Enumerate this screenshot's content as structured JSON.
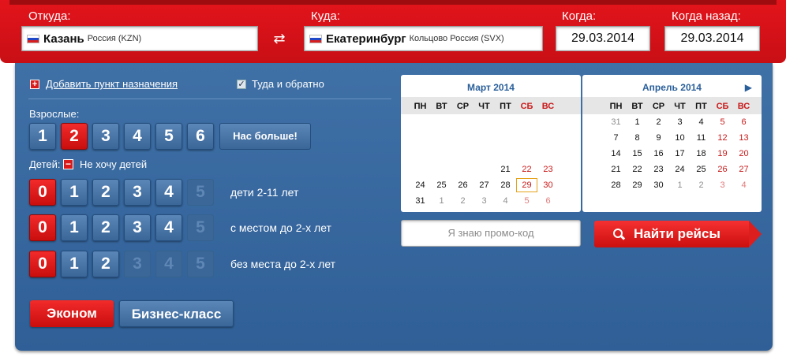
{
  "search": {
    "from_label": "Откуда:",
    "to_label": "Куда:",
    "when_label": "Когда:",
    "back_label": "Когда назад:",
    "from_city": "Казань",
    "from_sub": "Россия (KZN)",
    "to_city": "Екатеринбург",
    "to_sub": "Кольцово Россия (SVX)",
    "depart_date": "29.03.2014",
    "return_date": "29.03.2014",
    "swap_glyph": "⇄"
  },
  "options": {
    "add_destination": "Добавить пункт назначения",
    "add_glyph": "+",
    "roundtrip": "Туда и обратно",
    "roundtrip_checked": true,
    "check_glyph": "✓"
  },
  "adults": {
    "label": "Взрослые:",
    "numbers": [
      "1",
      "2",
      "3",
      "4",
      "5",
      "6"
    ],
    "selected": "2",
    "more_label": "Нас больше!"
  },
  "children": {
    "label": "Детей:",
    "no_children": "Не хочу детей",
    "minus_glyph": "−",
    "rows": [
      {
        "label": "дети 2-11 лет",
        "numbers": [
          "0",
          "1",
          "2",
          "3",
          "4",
          "5"
        ]
      },
      {
        "label": "с местом до 2-х лет",
        "numbers": [
          "0",
          "1",
          "2",
          "3",
          "4",
          "5"
        ]
      },
      {
        "label": "без места до 2-х лет",
        "numbers": [
          "0",
          "1",
          "2",
          "3",
          "4",
          "5"
        ]
      }
    ]
  },
  "classes": {
    "economy": "Эконом",
    "business": "Бизнес-класс"
  },
  "calendar": {
    "weekdays": [
      "ПН",
      "ВТ",
      "СР",
      "ЧТ",
      "ПТ",
      "СБ",
      "ВС"
    ],
    "months": [
      {
        "title": "Март 2014",
        "days": [
          [
            "",
            "",
            "",
            "",
            "",
            "",
            ""
          ],
          [
            "",
            "",
            "",
            "",
            "",
            "",
            ""
          ],
          [
            "",
            "",
            "",
            "",
            "",
            "",
            ""
          ],
          [
            "",
            "",
            "",
            "",
            "21",
            "22",
            "23"
          ],
          [
            "24",
            "25",
            "26",
            "27",
            "28",
            "29",
            "30"
          ],
          [
            "31",
            "1",
            "2",
            "3",
            "4",
            "5",
            "6"
          ]
        ]
      },
      {
        "title": "Апрель 2014",
        "next_glyph": "▶",
        "days": [
          [
            "31",
            "1",
            "2",
            "3",
            "4",
            "5",
            "6"
          ],
          [
            "7",
            "8",
            "9",
            "10",
            "11",
            "12",
            "13"
          ],
          [
            "14",
            "15",
            "16",
            "17",
            "18",
            "19",
            "20"
          ],
          [
            "21",
            "22",
            "23",
            "24",
            "25",
            "26",
            "27"
          ],
          [
            "28",
            "29",
            "30",
            "1",
            "2",
            "3",
            "4"
          ],
          [
            "",
            "",
            "",
            "",
            "",
            "",
            ""
          ]
        ]
      }
    ],
    "selected_day": "29"
  },
  "promo_placeholder": "Я знаю промо-код",
  "find_label": "Найти рейсы",
  "colors": {
    "red": "#d91b1b",
    "blue": "#3a6698",
    "header_text": "#2a5f9a"
  }
}
